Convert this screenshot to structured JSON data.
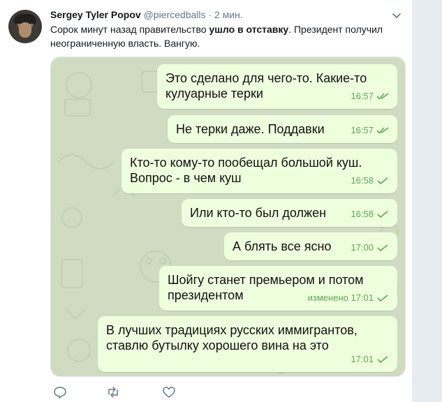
{
  "tweet": {
    "author_name": "Sergey Tyler Popov",
    "handle": "@piercedballs",
    "separator": "·",
    "time": "2 мин.",
    "text_part1": "Сорок минут назад правительство ",
    "text_bold": "ушло в отставку",
    "text_part2": ". Президент получил неограниченную власть. Вангую."
  },
  "chat": {
    "messages": [
      {
        "text": "Это сделано для чего-то. Какие-то\nкулуарные терки",
        "time": "16:57",
        "status": "double-check"
      },
      {
        "text": "Не терки даже. Поддавки",
        "time": "16:57",
        "status": "double-check"
      },
      {
        "text": "Кто-то кому-то пообещал большой куш.\nВопрос - в чем куш",
        "time": "16:58",
        "status": "check"
      },
      {
        "text": "Или кто-то был должен",
        "time": "16:58",
        "status": "check"
      },
      {
        "text": "А блять все ясно",
        "time": "17:00",
        "status": "check"
      },
      {
        "text": "Шойгу станет премьером и потом\nпрезидентом",
        "time": "изменено 17:01",
        "status": "check"
      },
      {
        "text": "В лучших традициях русских иммигрантов,\nставлю бутылку хорошего вина на это",
        "time": "17:01",
        "status": "check"
      }
    ]
  },
  "actions": {
    "icons": [
      "reply-icon",
      "retweet-icon",
      "like-icon"
    ]
  },
  "colors": {
    "bubble": "#eeffde",
    "chat_bg": "#cfdcc1",
    "checkmarks": "#5ea45a",
    "muted": "#657786"
  }
}
